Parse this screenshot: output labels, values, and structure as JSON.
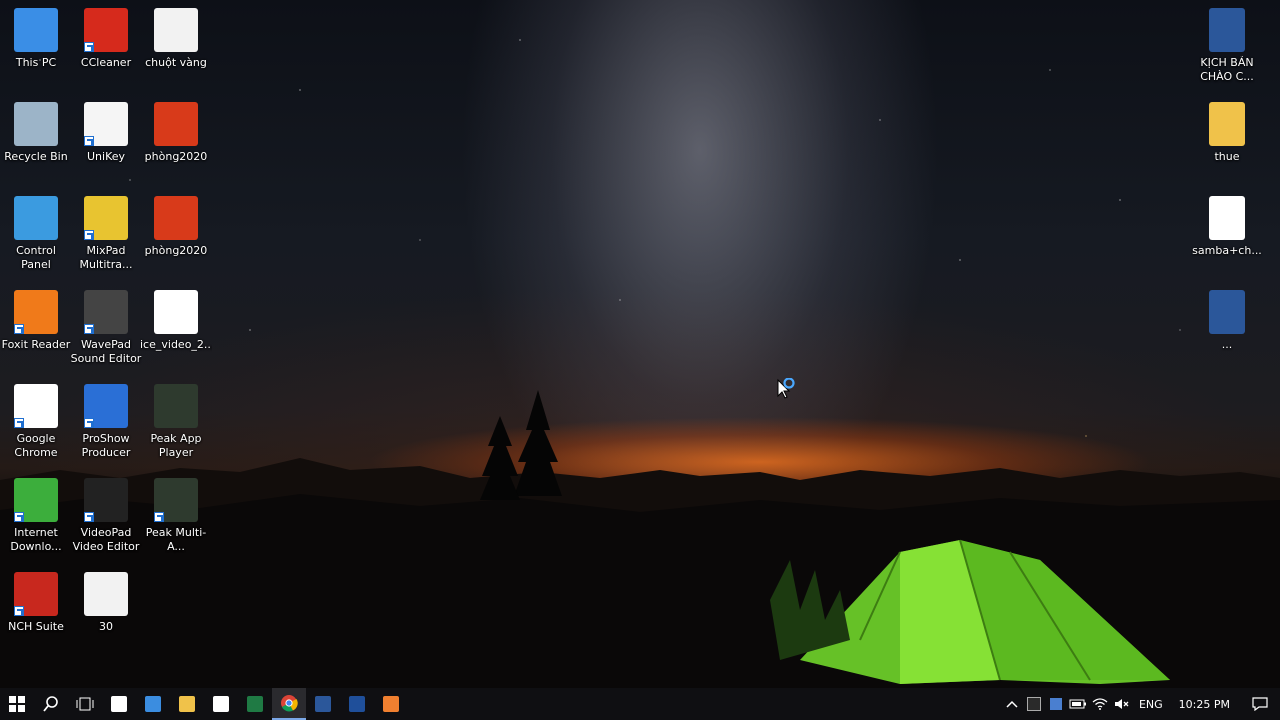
{
  "desktop": {
    "left_icons": [
      {
        "name": "This PC",
        "icon": "this-pc-icon",
        "color": "#3a8ee6",
        "shortcut": false
      },
      {
        "name": "CCleaner",
        "icon": "ccleaner-icon",
        "color": "#d62a1c",
        "shortcut": true
      },
      {
        "name": "chuột vàng",
        "icon": "photoshop-image-icon",
        "color": "#f2f2f2",
        "shortcut": false
      },
      {
        "name": "Recycle Bin",
        "icon": "recycle-bin-icon",
        "color": "#9cb4c8",
        "shortcut": false
      },
      {
        "name": "UniKey",
        "icon": "unikey-icon",
        "color": "#f5f5f5",
        "shortcut": true
      },
      {
        "name": "phòng2020",
        "icon": "photoshop-image-icon",
        "color": "#d83a1a",
        "shortcut": false
      },
      {
        "name": "Control Panel",
        "icon": "control-panel-icon",
        "color": "#3b9be0",
        "shortcut": false
      },
      {
        "name": "MixPad Multitra...",
        "icon": "mixpad-icon",
        "color": "#e8c430",
        "shortcut": true
      },
      {
        "name": "phòng2020",
        "icon": "photoshop-image-icon",
        "color": "#d83a1a",
        "shortcut": false
      },
      {
        "name": "Foxit Reader",
        "icon": "foxit-reader-icon",
        "color": "#f07a1a",
        "shortcut": true
      },
      {
        "name": "WavePad Sound Editor",
        "icon": "wavepad-icon",
        "color": "#444444",
        "shortcut": true
      },
      {
        "name": "ice_video_2...",
        "icon": "video-file-icon",
        "color": "#ffffff",
        "shortcut": false
      },
      {
        "name": "Google Chrome",
        "icon": "chrome-icon",
        "color": "#ffffff",
        "shortcut": true
      },
      {
        "name": "ProShow Producer",
        "icon": "proshow-icon",
        "color": "#2a6fd6",
        "shortcut": true
      },
      {
        "name": "Peak App Player",
        "icon": "peak-app-icon",
        "color": "#2e3a2e",
        "shortcut": false
      },
      {
        "name": "Internet Downlo...",
        "icon": "idm-icon",
        "color": "#3cae3c",
        "shortcut": true
      },
      {
        "name": "VideoPad Video Editor",
        "icon": "videopad-icon",
        "color": "#222222",
        "shortcut": true
      },
      {
        "name": "Peak Multi-A...",
        "icon": "peak-multi-icon",
        "color": "#2e3a2e",
        "shortcut": true
      },
      {
        "name": "NCH Suite",
        "icon": "nch-suite-icon",
        "color": "#c8281e",
        "shortcut": true
      },
      {
        "name": "30",
        "icon": "photoshop-image-icon",
        "color": "#f2f2f2",
        "shortcut": false
      }
    ],
    "right_icons": [
      {
        "name": "KỊCH BẢN CHÀO C...",
        "icon": "word-document-icon",
        "color": "#2b579a"
      },
      {
        "name": "thue",
        "icon": "folder-zip-icon",
        "color": "#f0c24a"
      },
      {
        "name": "samba+ch...",
        "icon": "mp3-file-icon",
        "color": "#ffffff"
      },
      {
        "name": "...",
        "icon": "word-document-icon",
        "color": "#2b579a"
      }
    ]
  },
  "taskbar": {
    "apps": [
      {
        "icon": "windows-start-icon",
        "color": "#ffffff"
      },
      {
        "icon": "search-icon",
        "color": "#ffffff"
      },
      {
        "icon": "task-view-icon",
        "color": "#ffffff"
      },
      {
        "icon": "store-icon",
        "color": "#ffffff"
      },
      {
        "icon": "edge-icon",
        "color": "#3b8de0"
      },
      {
        "icon": "file-explorer-icon",
        "color": "#f0c24a"
      },
      {
        "icon": "mail-icon",
        "color": "#ffffff"
      },
      {
        "icon": "excel-icon",
        "color": "#1f7a44"
      },
      {
        "icon": "chrome-icon",
        "color": "#e8e8e8"
      },
      {
        "icon": "word-icon",
        "color": "#2b579a"
      },
      {
        "icon": "photoshop-icon",
        "color": "#1f4f9a"
      },
      {
        "icon": "app-icon",
        "color": "#f08030"
      }
    ],
    "active_index": 8,
    "tray": {
      "language": "ENG",
      "time": "10:25 PM"
    }
  }
}
